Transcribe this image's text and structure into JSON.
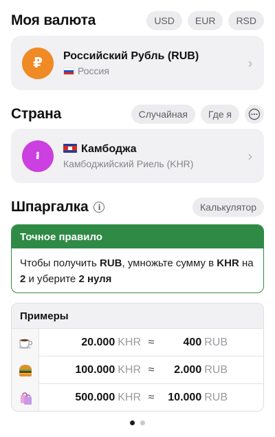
{
  "currency_section": {
    "title": "Моя валюта",
    "chips": [
      "USD",
      "EUR",
      "RSD"
    ],
    "card": {
      "avatar_symbol": "₽",
      "avatar_color": "#f08a24",
      "title": "Российский Рубль (RUB)",
      "subtitle": "Россия"
    }
  },
  "country_section": {
    "title": "Страна",
    "chips": [
      "Случайная",
      "Где я"
    ],
    "more_icon": "more-horizontal-icon",
    "card": {
      "avatar_symbol": "៛",
      "avatar_color": "#cc3fe0",
      "title": "Камбоджа",
      "subtitle": "Камбоджийский Риель (KHR)"
    }
  },
  "cheatsheet": {
    "title": "Шпаргалка",
    "calculator_label": "Калькулятор",
    "rule": {
      "header": "Точное правило",
      "text_1": "Чтобы получить ",
      "target": "RUB",
      "text_2": ", умножьте сумму в ",
      "source": "KHR",
      "text_3": " на ",
      "multiplier": "2",
      "text_4": " и уберите ",
      "zeros": "2 нуля"
    },
    "examples": {
      "header": "Примеры",
      "approx": "≈",
      "rows": [
        {
          "icon": "coffee-cup-icon",
          "from": "20.000",
          "from_cur": "KHR",
          "to": "400",
          "to_cur": "RUB"
        },
        {
          "icon": "burger-icon",
          "from": "100.000",
          "from_cur": "KHR",
          "to": "2.000",
          "to_cur": "RUB"
        },
        {
          "icon": "shopping-bags-icon",
          "from": "500.000",
          "from_cur": "KHR",
          "to": "10.000",
          "to_cur": "RUB"
        }
      ]
    }
  },
  "pager": {
    "current": 1,
    "total": 2
  },
  "colors": {
    "accent_green": "#2f8a45",
    "rub_orange": "#f08a24",
    "khr_purple": "#cc3fe0"
  }
}
